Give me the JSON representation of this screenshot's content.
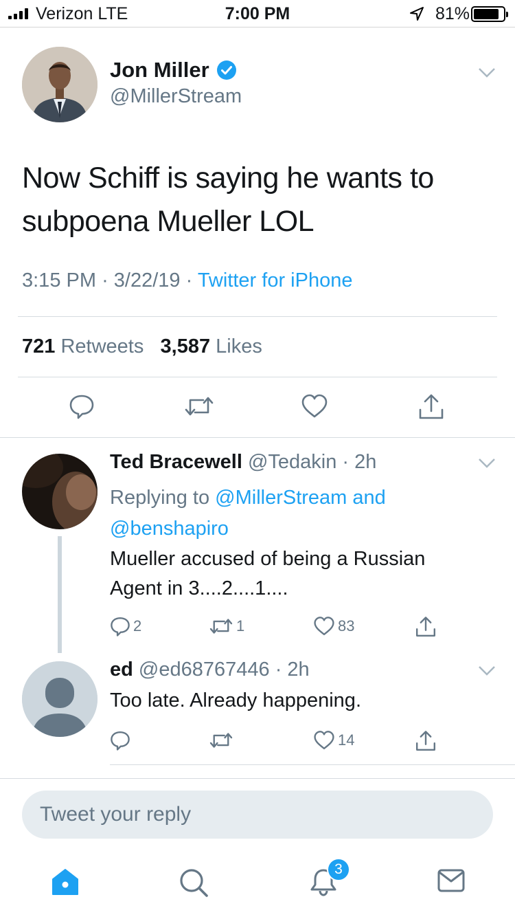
{
  "status_bar": {
    "carrier": "Verizon  LTE",
    "time": "7:00 PM",
    "battery": "81%"
  },
  "main_tweet": {
    "name": "Jon Miller",
    "handle": "@MillerStream",
    "verified": true,
    "text": "Now Schiff is saying he wants to subpoena Mueller LOL",
    "time": "3:15 PM",
    "date": "3/22/19",
    "source": "Twitter for iPhone",
    "retweets_count": "721",
    "retweets_label": "Retweets",
    "likes_count": "3,587",
    "likes_label": "Likes"
  },
  "replies": [
    {
      "name": "Ted Bracewell",
      "handle": "@Tedakin",
      "time": "2h",
      "replying_prefix": "Replying to",
      "replying_to": "@MillerStream and @benshapiro",
      "text": "Mueller accused of being a Russian Agent in 3....2....1....",
      "reply_count": "2",
      "retweet_count": "1",
      "like_count": "83"
    },
    {
      "name": "ed",
      "handle": "@ed68767446",
      "time": "2h",
      "text": "Too late. Already happening.",
      "reply_count": "",
      "retweet_count": "",
      "like_count": "14"
    }
  ],
  "compose": {
    "placeholder": "Tweet your reply"
  },
  "tab_bar": {
    "notifications_badge": "3"
  },
  "colors": {
    "accent": "#1da1f2",
    "secondary_text": "#657786",
    "divider": "#d6dbe0"
  }
}
